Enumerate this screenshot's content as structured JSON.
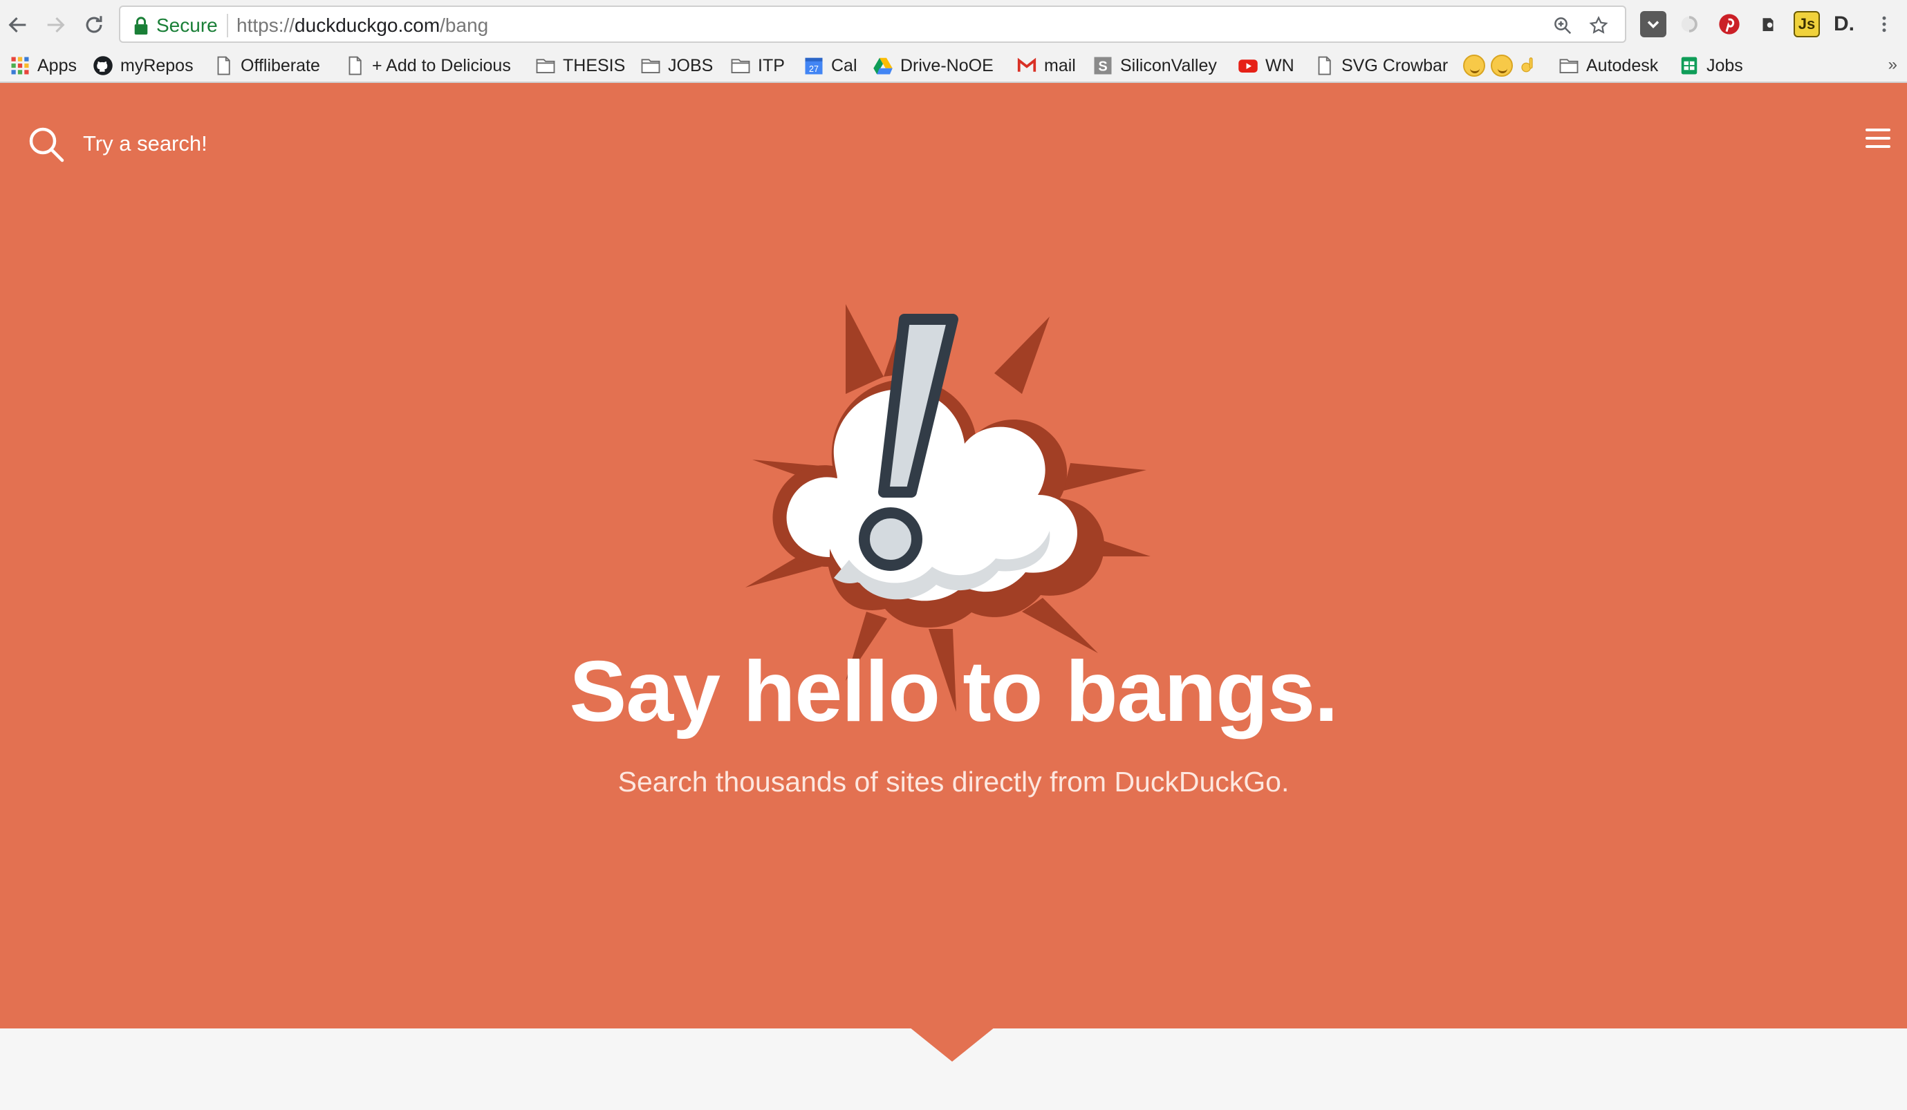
{
  "browser": {
    "secure_label": "Secure",
    "url_scheme": "https://",
    "url_host": "duckduckgo.com",
    "url_path": "/bang",
    "bookmarks": [
      {
        "label": "Apps",
        "icon": "apps-grid-icon"
      },
      {
        "label": "myRepos",
        "icon": "github-icon"
      },
      {
        "label": "Offliberate",
        "icon": "page-icon"
      },
      {
        "label": "+ Add to Delicious",
        "icon": "page-icon"
      },
      {
        "label": "THESIS",
        "icon": "folder-icon"
      },
      {
        "label": "JOBS",
        "icon": "folder-icon"
      },
      {
        "label": "ITP",
        "icon": "folder-icon"
      },
      {
        "label": "Cal",
        "icon": "calendar-icon"
      },
      {
        "label": "Drive-NoOE",
        "icon": "drive-icon"
      },
      {
        "label": "mail",
        "icon": "gmail-icon"
      },
      {
        "label": "SiliconValley",
        "icon": "siliconvalley-icon"
      },
      {
        "label": "WN",
        "icon": "youtube-icon"
      },
      {
        "label": "SVG Crowbar",
        "icon": "page-icon"
      },
      {
        "label": "Autodesk",
        "icon": "folder-icon"
      },
      {
        "label": "Jobs",
        "icon": "sheets-icon"
      }
    ],
    "calendar_day": "27",
    "overflow": "»"
  },
  "page": {
    "search_placeholder": "Try a search!",
    "headline": "Say hello to bangs.",
    "subheadline": "Search thousands of sites directly from DuckDuckGo."
  },
  "colors": {
    "hero_bg": "#e37151",
    "burst": "#a23f25",
    "exclamation_stroke": "#323c47",
    "exclamation_fill": "#d4dadf",
    "page_bg": "#f6f6f6"
  }
}
